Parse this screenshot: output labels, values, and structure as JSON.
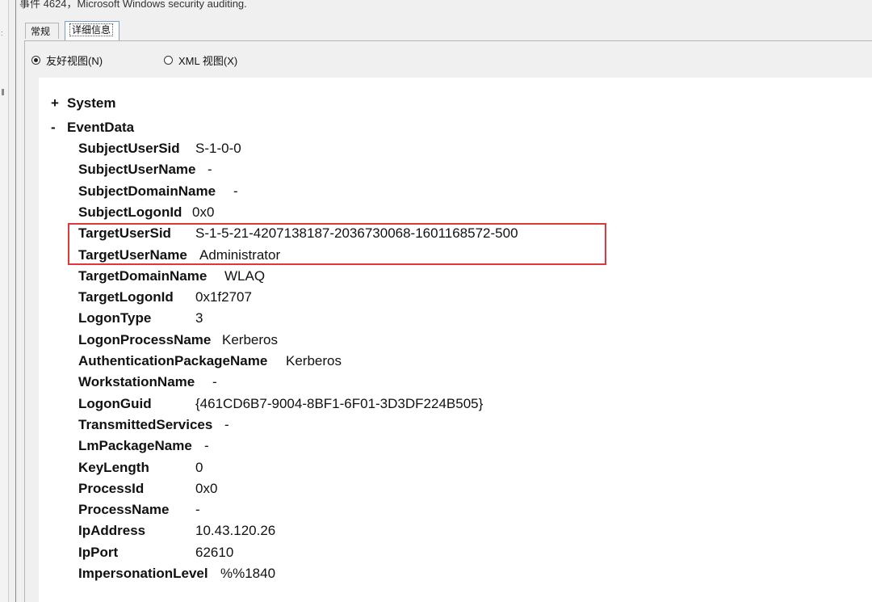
{
  "window": {
    "title": "事件 4624，Microsoft Windows security auditing."
  },
  "tabs": [
    {
      "label": "常规",
      "selected": false
    },
    {
      "label": "详细信息",
      "selected": true
    }
  ],
  "view_options": {
    "friendly": {
      "label": "友好视图(N)",
      "checked": true
    },
    "xml": {
      "label": "XML 视图(X)",
      "checked": false
    }
  },
  "tree": {
    "system": {
      "sign": "+",
      "label": "System"
    },
    "eventdata": {
      "sign": "-",
      "label": "EventData"
    }
  },
  "event_data": [
    {
      "key": "SubjectUserSid",
      "value": "S-1-0-0"
    },
    {
      "key": "SubjectUserName",
      "value": "-"
    },
    {
      "key": "SubjectDomainName",
      "value": "-"
    },
    {
      "key": "SubjectLogonId",
      "value": "0x0"
    },
    {
      "key": "TargetUserSid",
      "value": "S-1-5-21-4207138187-2036730068-1601168572-500"
    },
    {
      "key": "TargetUserName",
      "value": "Administrator"
    },
    {
      "key": "TargetDomainName",
      "value": "WLAQ"
    },
    {
      "key": "TargetLogonId",
      "value": "0x1f2707"
    },
    {
      "key": "LogonType",
      "value": "3"
    },
    {
      "key": "LogonProcessName",
      "value": "Kerberos"
    },
    {
      "key": "AuthenticationPackageName",
      "value": "Kerberos"
    },
    {
      "key": "WorkstationName",
      "value": "-"
    },
    {
      "key": "LogonGuid",
      "value": "{461CD6B7-9004-8BF1-6F01-3D3DF224B505}"
    },
    {
      "key": "TransmittedServices",
      "value": "-"
    },
    {
      "key": "LmPackageName",
      "value": "-"
    },
    {
      "key": "KeyLength",
      "value": "0"
    },
    {
      "key": "ProcessId",
      "value": "0x0"
    },
    {
      "key": "ProcessName",
      "value": "-"
    },
    {
      "key": "IpAddress",
      "value": "10.43.120.26"
    },
    {
      "key": "IpPort",
      "value": "62610"
    },
    {
      "key": "ImpersonationLevel",
      "value": "%%1840"
    }
  ],
  "annotation": {
    "color": "#e0373b"
  }
}
